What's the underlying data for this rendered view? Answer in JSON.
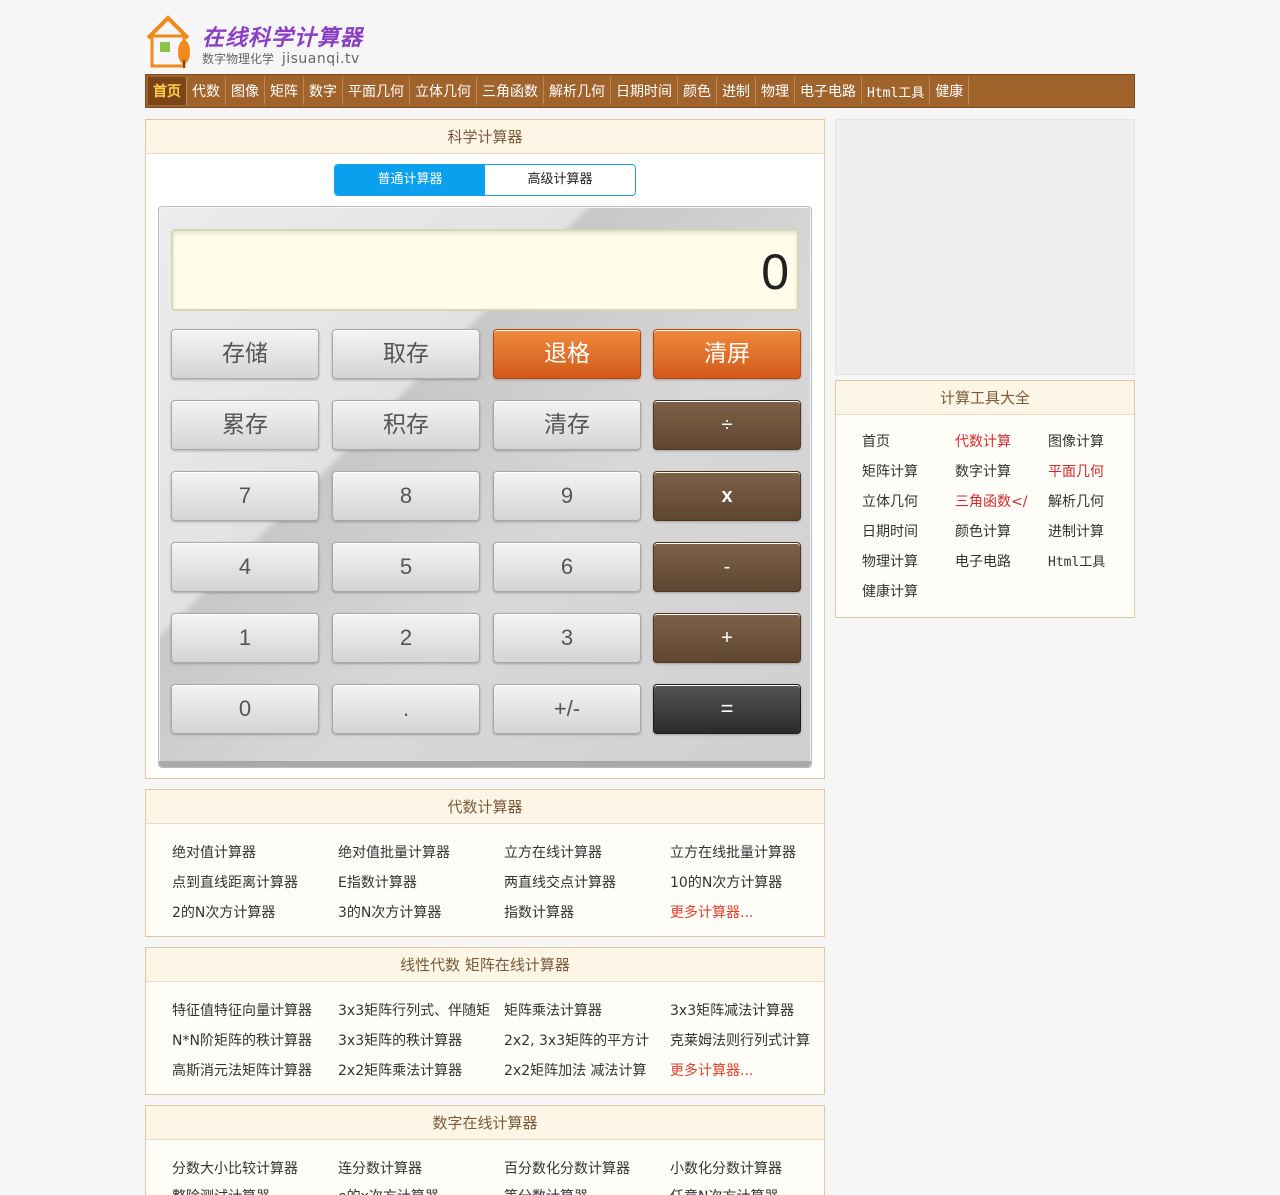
{
  "logo": {
    "title": "在线科学计算器",
    "subtitle": "数字物理化学",
    "domain": "jisuanqi.tv"
  },
  "nav": [
    "首页",
    "代数",
    "图像",
    "矩阵",
    "数字",
    "平面几何",
    "立体几何",
    "三角函数",
    "解析几何",
    "日期时间",
    "颜色",
    "进制",
    "物理",
    "电子电路",
    "Html工具",
    "健康"
  ],
  "calculator": {
    "title": "科学计算器",
    "tabs": [
      "普通计算器",
      "高级计算器"
    ],
    "display": "0",
    "buttons": [
      [
        "存储",
        "取存",
        "退格",
        "清屏"
      ],
      [
        "累存",
        "积存",
        "清存",
        "÷"
      ],
      [
        "7",
        "8",
        "9",
        "x"
      ],
      [
        "4",
        "5",
        "6",
        "-"
      ],
      [
        "1",
        "2",
        "3",
        "+"
      ],
      [
        "0",
        ".",
        "+/-",
        "="
      ]
    ]
  },
  "tools": {
    "title": "计算工具大全",
    "items": [
      "首页",
      "代数计算",
      "图像计算",
      "矩阵计算",
      "数字计算",
      "平面几何",
      "立体几何",
      "三角函数</",
      "解析几何",
      "日期时间",
      "颜色计算",
      "进制计算",
      "物理计算",
      "电子电路",
      "Html工具",
      "健康计算"
    ]
  },
  "algebra": {
    "title": "代数计算器",
    "items": [
      "绝对值计算器",
      "绝对值批量计算器",
      "立方在线计算器",
      "立方在线批量计算器",
      "点到直线距离计算器",
      "E指数计算器",
      "两直线交点计算器",
      "10的N次方计算器",
      "2的N次方计算器",
      "3的N次方计算器",
      "指数计算器",
      "更多计算器..."
    ]
  },
  "matrix": {
    "title": "线性代数 矩阵在线计算器",
    "items": [
      "特征值特征向量计算器",
      "3x3矩阵行列式、伴随矩",
      "矩阵乘法计算器",
      "3x3矩阵减法计算器",
      "N*N阶矩阵的秩计算器",
      "3x3矩阵的秩计算器",
      "2x2, 3x3矩阵的平方计",
      "克莱姆法则行列式计算",
      "高斯消元法矩阵计算器",
      "2x2矩阵乘法计算器",
      "2x2矩阵加法 减法计算",
      "更多计算器..."
    ]
  },
  "numbers": {
    "title": "数字在线计算器",
    "items": [
      "分数大小比较计算器",
      "连分数计算器",
      "百分数化分数计算器",
      "小数化分数计算器",
      "整除测试计算器",
      "e的x次方计算器",
      "等分数计算器",
      "任意N次方计算器"
    ]
  }
}
